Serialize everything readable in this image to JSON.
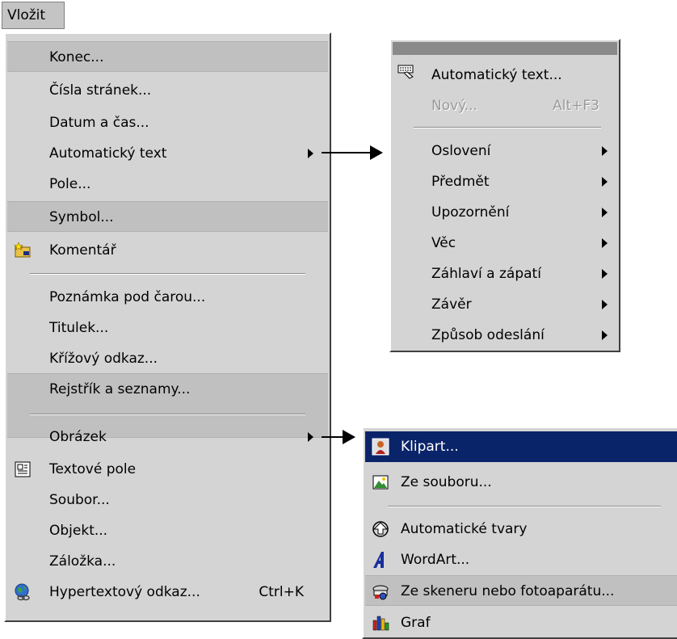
{
  "menu": {
    "title": "Vložit",
    "items": [
      {
        "label": "Konec..."
      },
      {
        "label": "Čísla stránek..."
      },
      {
        "label": "Datum a čas..."
      },
      {
        "label": "Automatický text"
      },
      {
        "label": "Pole..."
      },
      {
        "label": "Symbol..."
      },
      {
        "label": "Komentář"
      },
      {
        "label": "Poznámka pod čarou..."
      },
      {
        "label": "Titulek..."
      },
      {
        "label": "Křížový odkaz..."
      },
      {
        "label": "Rejstřík a seznamy..."
      },
      {
        "label": "Obrázek"
      },
      {
        "label": "Textové pole"
      },
      {
        "label": "Soubor..."
      },
      {
        "label": "Objekt..."
      },
      {
        "label": "Záložka..."
      },
      {
        "label": "Hypertextový odkaz...",
        "shortcut": "Ctrl+K"
      }
    ]
  },
  "autotext_submenu": {
    "items": [
      {
        "label": "Automatický text..."
      },
      {
        "label": "Nový...",
        "shortcut": "Alt+F3"
      },
      {
        "label": "Oslovení"
      },
      {
        "label": "Předmět"
      },
      {
        "label": "Upozornění"
      },
      {
        "label": "Věc"
      },
      {
        "label": "Záhlaví a zápatí"
      },
      {
        "label": "Závěr"
      },
      {
        "label": "Způsob odeslání"
      }
    ]
  },
  "picture_submenu": {
    "items": [
      {
        "label": "Klipart..."
      },
      {
        "label": "Ze souboru..."
      },
      {
        "label": "Automatické tvary"
      },
      {
        "label": "WordArt..."
      },
      {
        "label": "Ze skeneru nebo fotoaparátu..."
      },
      {
        "label": "Graf"
      }
    ]
  },
  "colors": {
    "menu_bg": "#d4d4d4",
    "selected_bg": "#0a2469",
    "selected_text": "#ffffff",
    "disabled_text": "#9a9a9a"
  }
}
